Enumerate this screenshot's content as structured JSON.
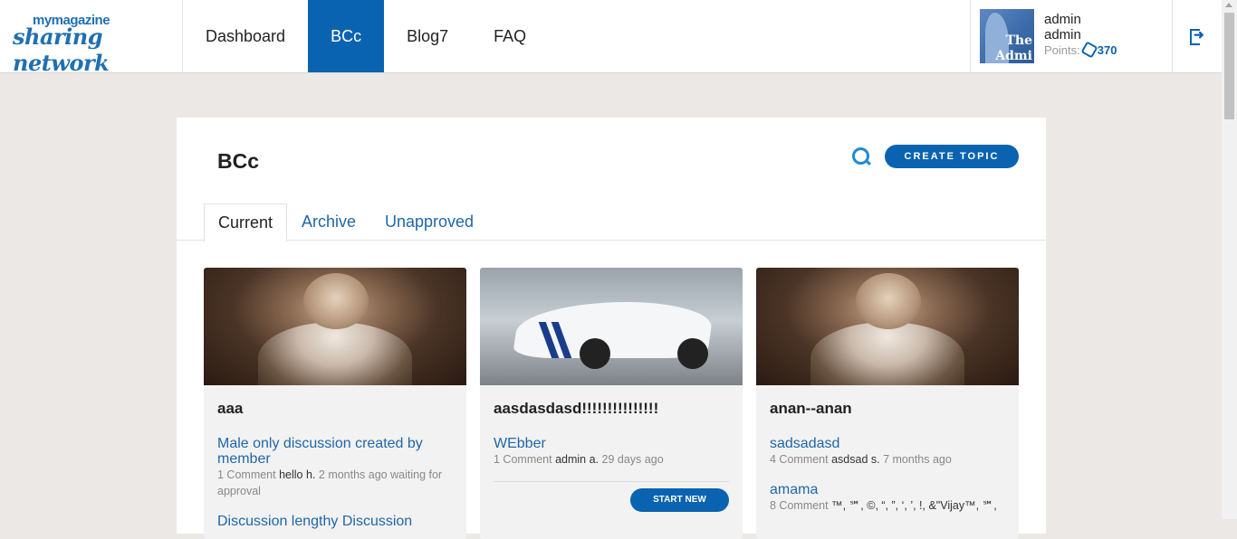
{
  "header": {
    "logo_small": "mymagazine",
    "logo_big": "sharing network",
    "nav": [
      {
        "label": "Dashboard"
      },
      {
        "label": "BCc"
      },
      {
        "label": "Blog7"
      },
      {
        "label": "FAQ"
      }
    ],
    "user": {
      "avatar_line1": "The",
      "avatar_line2": "Admi",
      "name1": "admin",
      "name2": "admin",
      "points_label": "Points:",
      "points_value": "370"
    }
  },
  "page": {
    "title": "BCc",
    "create_label": "CREATE TOPIC",
    "tabs": [
      {
        "label": "Current"
      },
      {
        "label": "Archive"
      },
      {
        "label": "Unapproved"
      }
    ]
  },
  "cards": [
    {
      "title": "aaa",
      "image": "cat-portrait",
      "discussions": [
        {
          "link": "Male only discussion created by member",
          "count": "1 Comment",
          "who": "hello h.",
          "when": "2 months ago waiting for approval"
        },
        {
          "link": "Discussion lengthy Discussion"
        }
      ]
    },
    {
      "title": "aasdasdasd!!!!!!!!!!!!!!!",
      "image": "white-car",
      "discussions": [
        {
          "link": "WEbber",
          "count": "1 Comment",
          "who": "admin a.",
          "when": "29 days ago"
        }
      ],
      "button": "START NEW"
    },
    {
      "title": "anan--anan",
      "image": "cat-portrait",
      "discussions": [
        {
          "link": "sadsadasd",
          "count": "4 Comment",
          "who": "asdsad s.",
          "when": "7 months ago"
        },
        {
          "link": "amama",
          "count": "8 Comment",
          "who": "™, ℠, ©, “, ”, ‘, ’, !, &\"Vijay™, ℠,",
          "when": ""
        }
      ]
    }
  ],
  "colors": {
    "accent": "#0a63b0",
    "link": "#2067a8",
    "background": "#ebe8e5"
  }
}
